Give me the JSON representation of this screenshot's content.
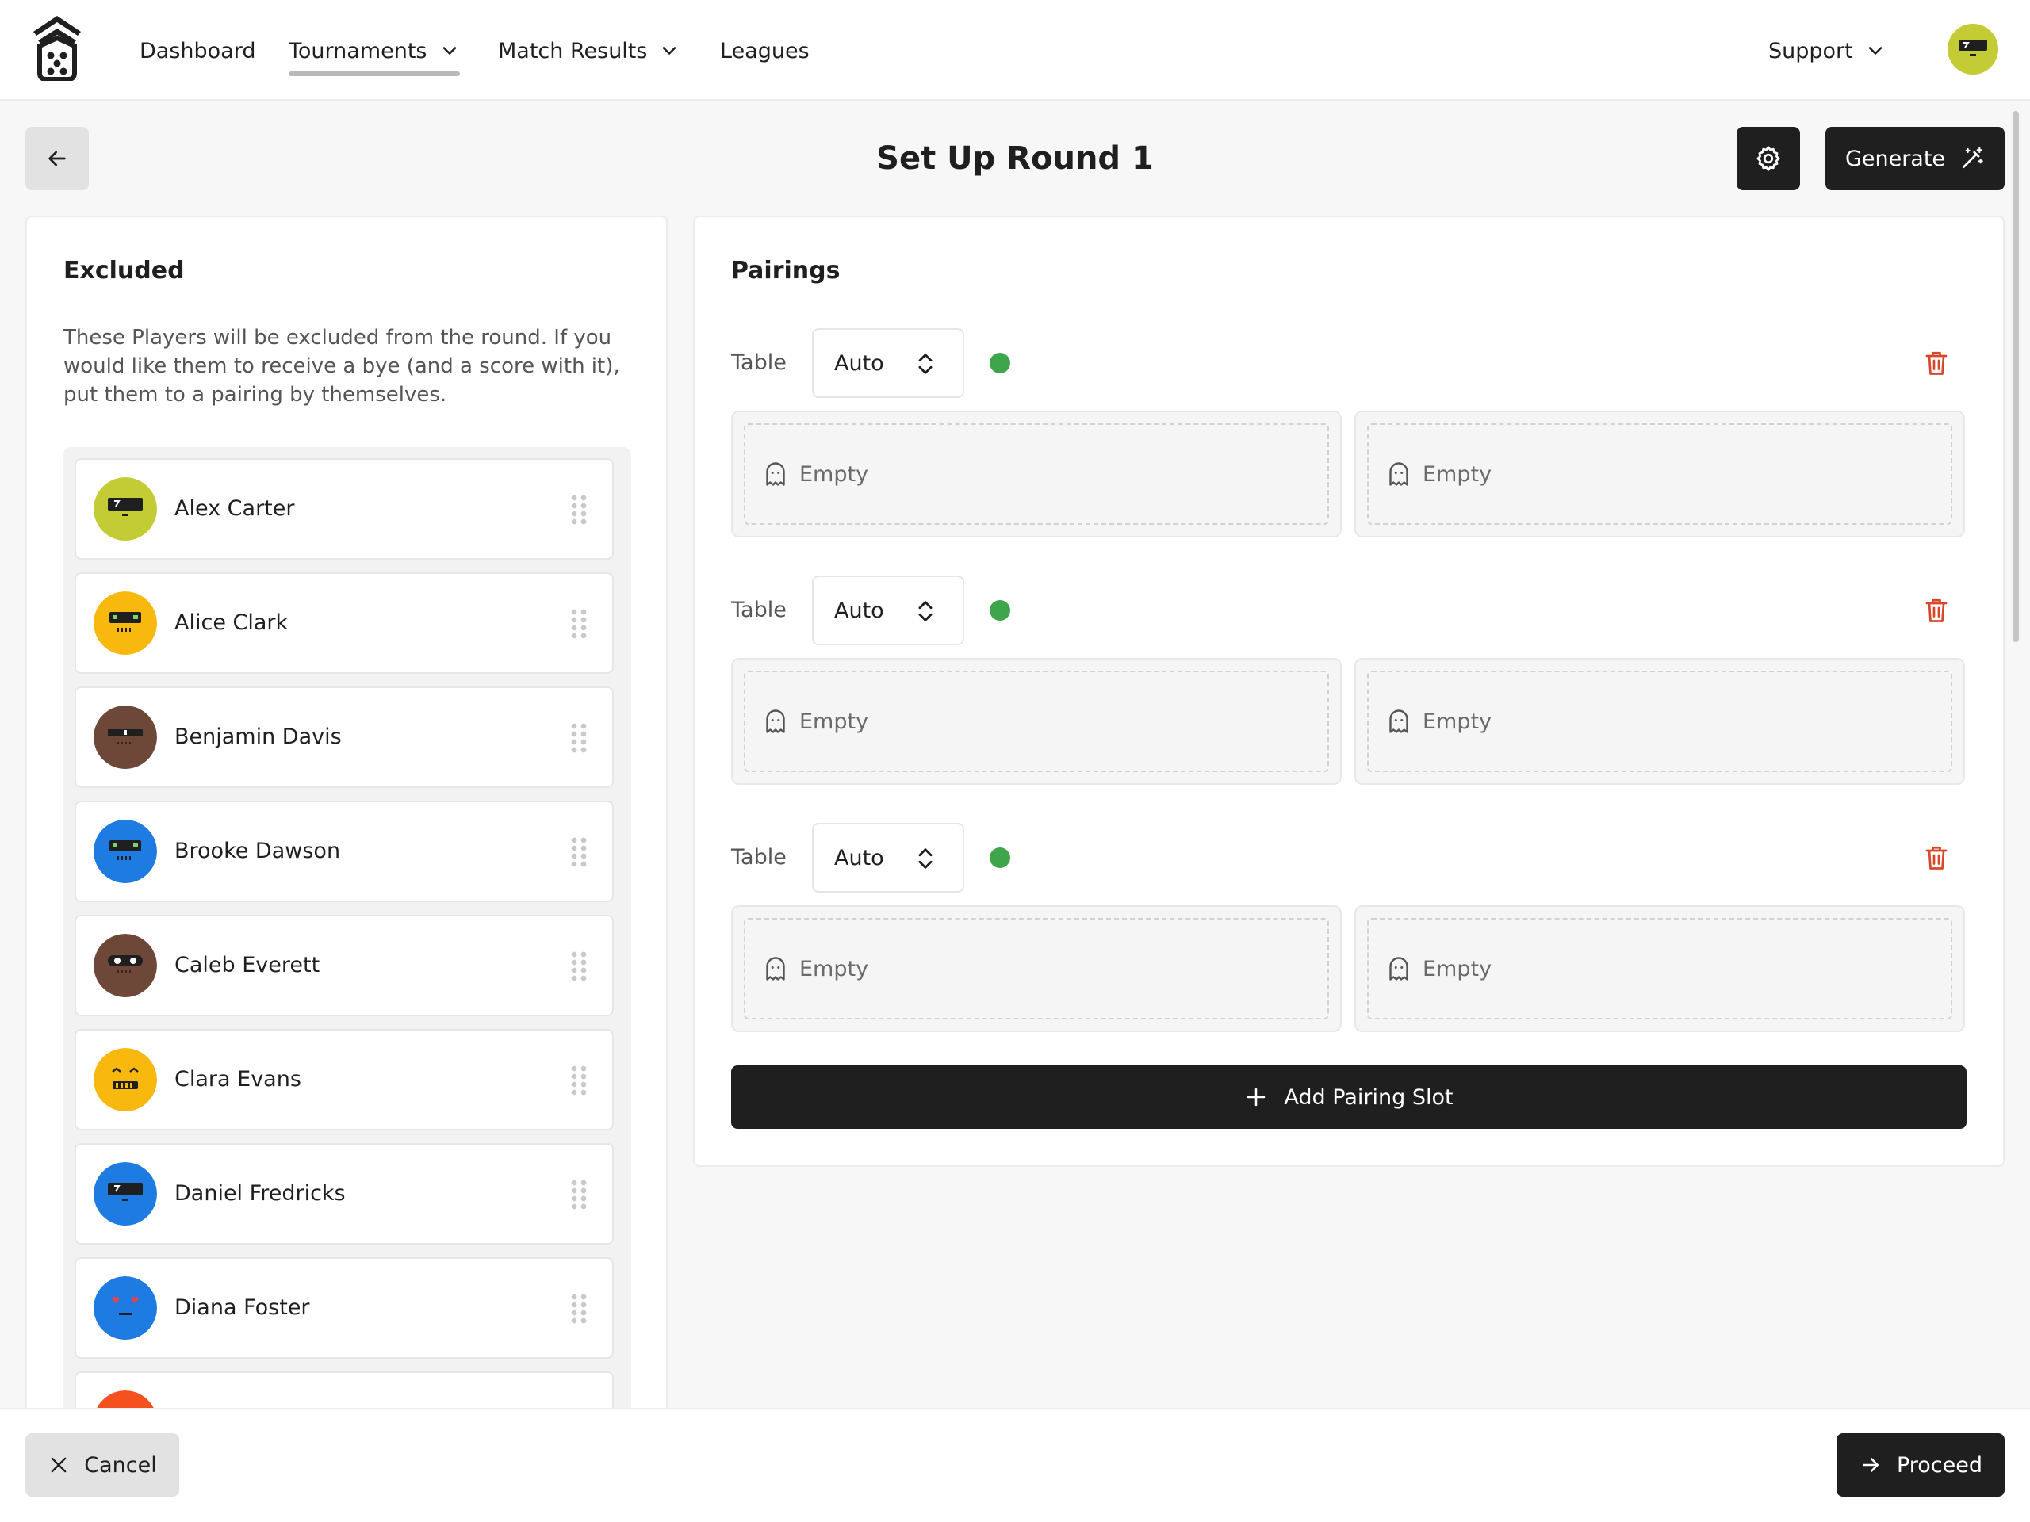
{
  "nav": {
    "items": [
      {
        "label": "Dashboard",
        "icon": ""
      },
      {
        "label": "Tournaments",
        "icon": "chevron-down-icon"
      },
      {
        "label": "Match Results",
        "icon": "chevron-down-icon"
      },
      {
        "label": "Leagues",
        "icon": ""
      }
    ],
    "active": "Tournaments",
    "support_label": "Support",
    "logo_icon": "dice-house-logo",
    "avatar_color": "#c3cc34"
  },
  "header": {
    "title": "Set Up Round 1",
    "back_icon": "arrow-left-icon",
    "settings_icon": "gear-icon",
    "generate_label": "Generate",
    "generate_icon": "magic-wand-icon"
  },
  "excluded": {
    "title": "Excluded",
    "description": "These Players will be excluded from the round. If you would like them to receive a bye (and a score with it), put them to a pairing by themselves.",
    "players": [
      {
        "name": "Alex Carter",
        "color": "#c3cc34",
        "face": "visor"
      },
      {
        "name": "Alice Clark",
        "color": "#f8b80d",
        "face": "robot"
      },
      {
        "name": "Benjamin Davis",
        "color": "#6d4738",
        "face": "shades"
      },
      {
        "name": "Brooke Dawson",
        "color": "#1e7be1",
        "face": "robot"
      },
      {
        "name": "Caleb Everett",
        "color": "#6d4738",
        "face": "goggles"
      },
      {
        "name": "Clara Evans",
        "color": "#f8b80d",
        "face": "grumpy"
      },
      {
        "name": "Daniel Fredricks",
        "color": "#1e7be1",
        "face": "visor"
      },
      {
        "name": "Diana Foster",
        "color": "#1e7be1",
        "face": "hearts"
      },
      {
        "name": "",
        "color": "#f4511e",
        "face": "none"
      }
    ]
  },
  "pairings": {
    "title": "Pairings",
    "rows": [
      {
        "table_label": "Table",
        "table_value": "Auto",
        "status_color": "#3ea54b",
        "slots": [
          "Empty",
          "Empty"
        ]
      },
      {
        "table_label": "Table",
        "table_value": "Auto",
        "status_color": "#3ea54b",
        "slots": [
          "Empty",
          "Empty"
        ]
      },
      {
        "table_label": "Table",
        "table_value": "Auto",
        "status_color": "#3ea54b",
        "slots": [
          "Empty",
          "Empty"
        ]
      }
    ],
    "add_label": "Add Pairing Slot",
    "delete_color": "#d9472b"
  },
  "footer": {
    "cancel_label": "Cancel",
    "proceed_label": "Proceed"
  }
}
